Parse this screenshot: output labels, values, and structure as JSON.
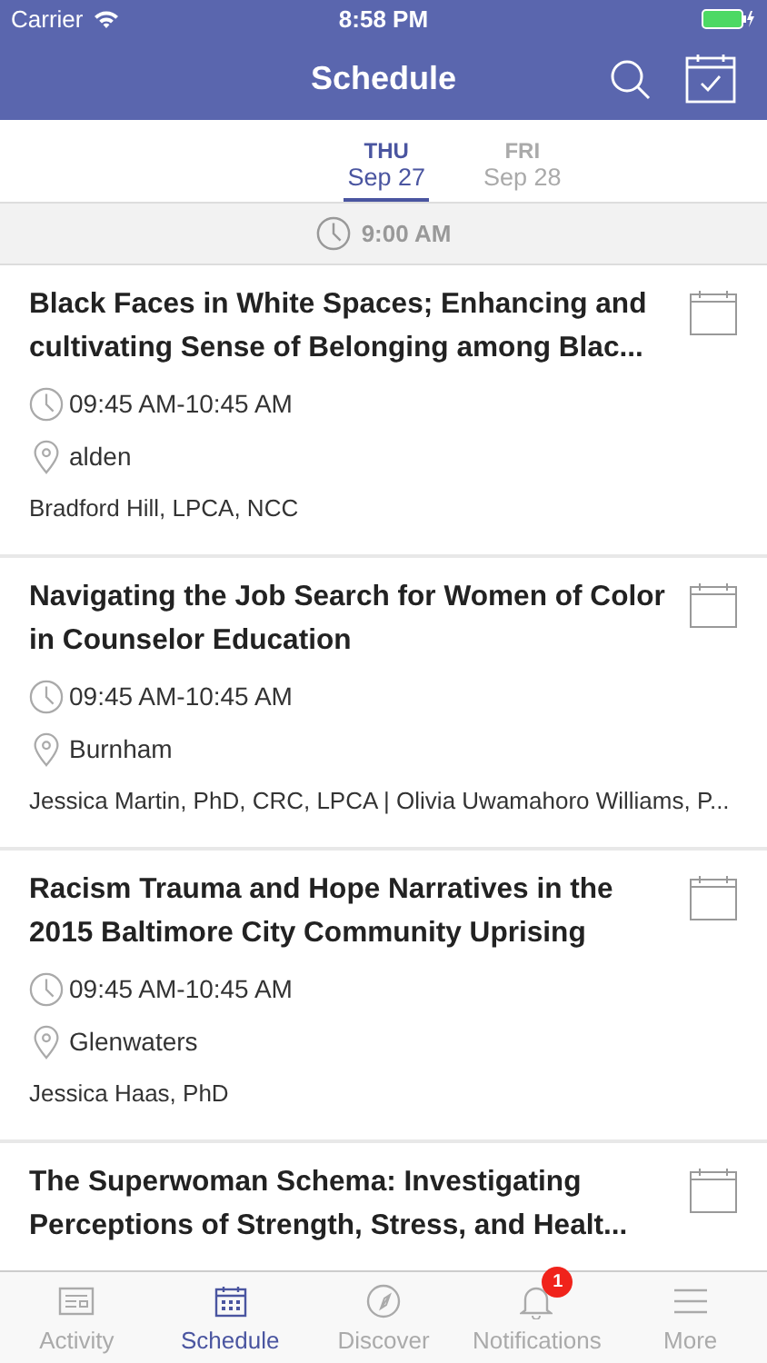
{
  "status_bar": {
    "carrier": "Carrier",
    "time": "8:58 PM"
  },
  "nav": {
    "title": "Schedule"
  },
  "days": [
    {
      "weekday": "THU",
      "date": "Sep 27",
      "selected": true
    },
    {
      "weekday": "FRI",
      "date": "Sep 28",
      "selected": false
    }
  ],
  "time_header": "9:00 AM",
  "sessions": [
    {
      "title": "Black Faces in White Spaces; Enhancing and cultivating Sense of Belonging among Blac...",
      "time": "09:45 AM-10:45 AM",
      "location": "alden",
      "speakers": "Bradford Hill, LPCA, NCC"
    },
    {
      "title": "Navigating the Job Search for Women of Color in Counselor Education",
      "time": "09:45 AM-10:45 AM",
      "location": "Burnham",
      "speakers": "Jessica Martin, PhD, CRC, LPCA | Olivia Uwamahoro Williams, P..."
    },
    {
      "title": "Racism Trauma and Hope Narratives in the 2015 Baltimore City Community Uprising",
      "time": "09:45 AM-10:45 AM",
      "location": "Glenwaters",
      "speakers": "Jessica Haas, PhD"
    },
    {
      "title": "The Superwoman Schema: Investigating Perceptions of Strength, Stress, and Healt..."
    }
  ],
  "tab_bar": [
    {
      "kind": "activity",
      "label": "Activity",
      "selected": false
    },
    {
      "kind": "schedule",
      "label": "Schedule",
      "selected": true
    },
    {
      "kind": "discover",
      "label": "Discover",
      "selected": false
    },
    {
      "kind": "notifications",
      "label": "Notifications",
      "selected": false,
      "badge": "1"
    },
    {
      "kind": "more",
      "label": "More",
      "selected": false
    }
  ]
}
